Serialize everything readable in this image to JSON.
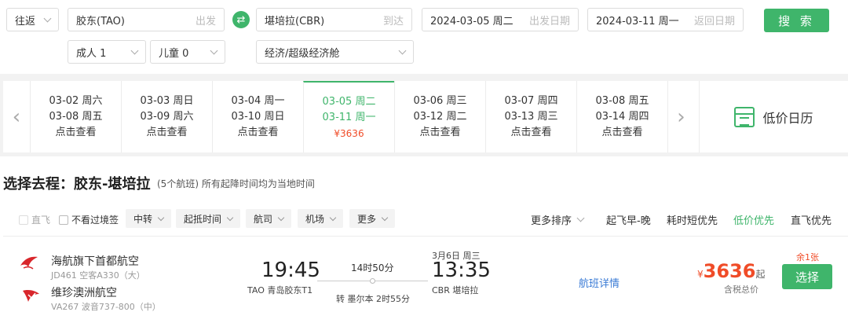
{
  "search": {
    "trip_type": "往返",
    "from_city": "胶东(TAO)",
    "from_tag": "出发",
    "to_city": "堪培拉(CBR)",
    "to_tag": "到达",
    "depart_date": "2024-03-05 周二",
    "depart_tag": "出发日期",
    "return_date": "2024-03-11 周一",
    "return_tag": "返回日期",
    "search_label": "搜 索",
    "adults": "成人 1",
    "children": "儿童 0",
    "cabin": "经济/超级经济舱",
    "swap_icon": "swap-icon"
  },
  "dates": [
    {
      "l1": "03-02 周六",
      "l2": "03-08 周五",
      "l3": "点击查看"
    },
    {
      "l1": "03-03 周日",
      "l2": "03-09 周六",
      "l3": "点击查看"
    },
    {
      "l1": "03-04 周一",
      "l2": "03-10 周日",
      "l3": "点击查看"
    },
    {
      "l1": "03-05 周二",
      "l2": "03-11 周一",
      "l3": "¥3636"
    },
    {
      "l1": "03-06 周三",
      "l2": "03-12 周二",
      "l3": "点击查看"
    },
    {
      "l1": "03-07 周四",
      "l2": "03-13 周三",
      "l3": "点击查看"
    },
    {
      "l1": "03-08 周五",
      "l2": "03-14 周四",
      "l3": "点击查看"
    }
  ],
  "calendar_label": "低价日历",
  "section": {
    "title": "选择去程：胶东-堪培拉",
    "subtitle": "(5个航班) 所有起降时间均为当地时间"
  },
  "filters": {
    "direct": "直飞",
    "no_transit_visa": "不看过境签",
    "transfer": "中转",
    "times": "起抵时间",
    "airline": "航司",
    "airport": "机场",
    "more": "更多",
    "more_sort": "更多排序",
    "sort_early": "起飞早-晚",
    "sort_short": "耗时短优先",
    "sort_low": "低价优先",
    "sort_direct": "直飞优先"
  },
  "flight": {
    "airline1": "海航旗下首都航空",
    "fno1": "JD461 空客A330（大）",
    "airline2": "维珍澳洲航空",
    "fno2": "VA267 波音737-800（中）",
    "dep_time": "19:45",
    "dep_port": "TAO 青岛胶东T1",
    "duration": "14时50分",
    "transfer": "转 墨尔本 2时55分",
    "arr_date": "3月6日 周三",
    "arr_time": "13:35",
    "arr_port": "CBR 堪培拉",
    "detail": "航班详情",
    "currency": "¥",
    "price": "3636",
    "price_suffix": "起",
    "tax_note": "含税总价",
    "remaining": "余1张",
    "select": "选择"
  },
  "colors": {
    "accent": "#3fb56b",
    "price": "#f04c28",
    "link": "#3a7bd5"
  }
}
